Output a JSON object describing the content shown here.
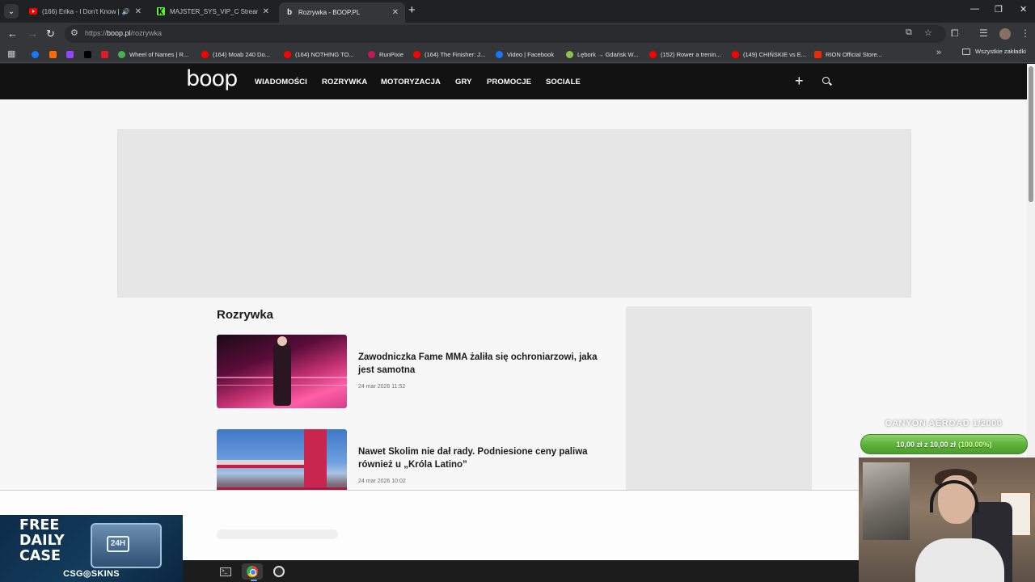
{
  "browser": {
    "tabs": [
      {
        "title": "(166) Erika - I Don't Know [",
        "favicon": "youtube-icon",
        "audio": true,
        "active": false
      },
      {
        "title": "MAJSTER_SYS_VIP_C Stream - V",
        "favicon": "kick-icon",
        "audio": false,
        "active": false
      },
      {
        "title": "Rozrywka - BOOP.PL",
        "favicon": "boop-icon",
        "audio": false,
        "active": true
      }
    ],
    "url_scheme": "https://",
    "url_host": "boop.pl",
    "url_path": "/rozrywka",
    "bookmarks": [
      {
        "label": "",
        "icon": "facebook-icon",
        "color": "#1877f2"
      },
      {
        "label": "",
        "icon": "orange-app-icon",
        "color": "#ff6a00"
      },
      {
        "label": "",
        "icon": "twitch-icon",
        "color": "#9146ff"
      },
      {
        "label": "",
        "icon": "x-icon",
        "color": "#000000"
      },
      {
        "label": "",
        "icon": "red-app-icon",
        "color": "#e01b24"
      },
      {
        "label": "Wheel of Names | R...",
        "icon": "wheel-icon",
        "color": "#4caf50"
      },
      {
        "label": "(164) Moab 240 Do...",
        "icon": "youtube-icon",
        "color": "#ff0000"
      },
      {
        "label": "(164) NOTHING TO...",
        "icon": "youtube-icon",
        "color": "#ff0000"
      },
      {
        "label": "RunPixie",
        "icon": "runpixie-icon",
        "color": "#c2185b"
      },
      {
        "label": "(164) The Finisher: J...",
        "icon": "youtube-icon",
        "color": "#ff0000"
      },
      {
        "label": "Video | Facebook",
        "icon": "facebook-icon",
        "color": "#1877f2"
      },
      {
        "label": "Lębork → Gdańsk W...",
        "icon": "maps-icon",
        "color": "#8bc34a"
      },
      {
        "label": "(152) Rower a trenin...",
        "icon": "youtube-icon",
        "color": "#ff0000"
      },
      {
        "label": "(149) CHIŃSKIE vs E...",
        "icon": "youtube-icon",
        "color": "#ff0000"
      },
      {
        "label": "RION Official Store...",
        "icon": "aliexpress-icon",
        "color": "#e62e04"
      }
    ],
    "all_bookmarks_label": "Wszystkie zakładki"
  },
  "site": {
    "logo": "boop",
    "nav": [
      "WIADOMOŚCI",
      "ROZRYWKA",
      "MOTORYZACJA",
      "GRY",
      "PROMOCJE",
      "SOCIALE"
    ],
    "section_title": "Rozrywka",
    "articles": [
      {
        "title": "Zawodniczka Fame MMA żaliła się ochroniarzowi, jaka jest samotna",
        "date": "24 mar 2026 11:52"
      },
      {
        "title": "Nawet Skolim nie dał rady. Podniesione ceny paliwa również u „Króla Latino”",
        "date": "24 mar 2026 10:02"
      }
    ]
  },
  "overlay": {
    "goal_title": "CANYON AEROAD 1/2000",
    "goal_amount": "10,00 zł",
    "goal_sep": "z",
    "goal_target": "10,00 zł",
    "goal_percent": "(100.00%)",
    "goal_progress": 1.0,
    "promo_text": "FREE DAILY CASE",
    "promo_case_number": "24H",
    "promo_brand": "CSG◎SKINS"
  },
  "colors": {
    "header_bg": "#121212",
    "page_bg": "#f7f7f7",
    "goal_green": "#5fb23d"
  }
}
